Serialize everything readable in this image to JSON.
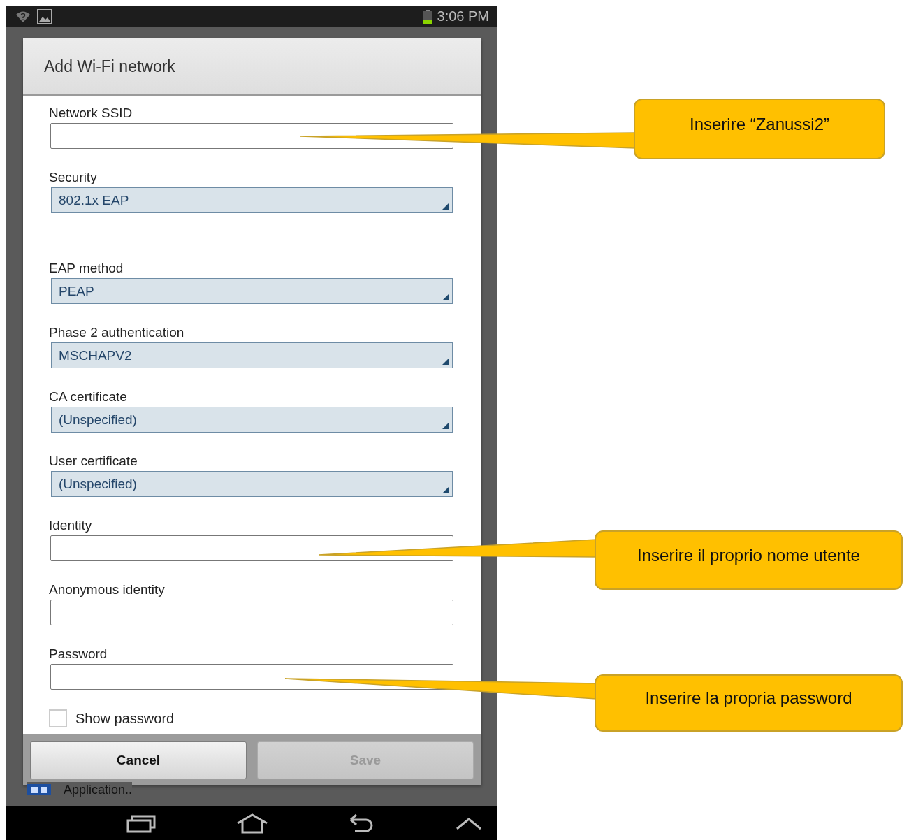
{
  "status_bar": {
    "time": "3:06 PM"
  },
  "background": {
    "label": "Application.."
  },
  "dialog": {
    "title": "Add Wi-Fi network",
    "fields": [
      {
        "kind": "text",
        "label": "Network SSID"
      },
      {
        "kind": "select",
        "label": "Security",
        "value": "802.1x EAP"
      },
      {
        "kind": "select",
        "label": "EAP method",
        "value": "PEAP"
      },
      {
        "kind": "select",
        "label": "Phase 2 authentication",
        "value": "MSCHAPV2"
      },
      {
        "kind": "select",
        "label": "CA certificate",
        "value": "(Unspecified)"
      },
      {
        "kind": "select",
        "label": "User certificate",
        "value": "(Unspecified)"
      },
      {
        "kind": "text",
        "label": "Identity"
      },
      {
        "kind": "text",
        "label": "Anonymous identity"
      },
      {
        "kind": "text",
        "label": "Password"
      }
    ],
    "show_password": {
      "label": "Show password",
      "checked": false
    },
    "buttons": [
      {
        "label": "Cancel",
        "disabled": false
      },
      {
        "label": "Save",
        "disabled": true
      }
    ]
  },
  "annotations": [
    {
      "text": "Inserire “Zanussi2”"
    },
    {
      "text": "Inserire il proprio nome utente"
    },
    {
      "text": "Inserire la propria password"
    }
  ]
}
